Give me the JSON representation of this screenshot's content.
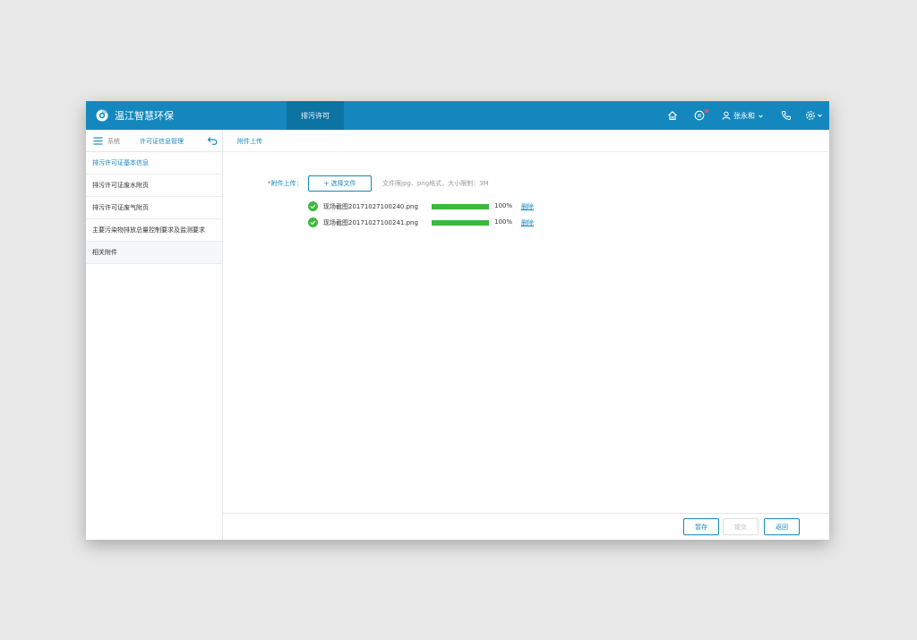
{
  "header": {
    "app_title": "温江智慧环保",
    "active_tab": "排污许可",
    "user_name": "张永和",
    "accent_color": "#1488be",
    "icons": [
      "home-icon",
      "message-icon",
      "user-icon",
      "phone-icon",
      "gear-icon"
    ]
  },
  "sidebar": {
    "system_label": "系统",
    "module_label": "许可证信息管理",
    "items": [
      {
        "label": "排污许可证基本信息"
      },
      {
        "label": "排污许可证废水附页"
      },
      {
        "label": "排污许可证废气附页"
      },
      {
        "label": "主要污染物排放总量控制要求及监测要求"
      },
      {
        "label": "相关附件"
      }
    ]
  },
  "content": {
    "section_title": "附件上传",
    "upload_label": "*附件上传：",
    "choose_button": "+ 选择文件",
    "hint": "文件限jpg、png格式，大小限制：3M",
    "files": [
      {
        "name": "现场截图20171027100240.png",
        "progress": "100%",
        "progress_value": 1.0,
        "delete_label": "删除"
      },
      {
        "name": "现场截图20171027100241.png",
        "progress": "100%",
        "progress_value": 1.0,
        "delete_label": "删除"
      }
    ]
  },
  "footer": {
    "save_label": "暂存",
    "submit_label": "提交",
    "back_label": "返回"
  }
}
